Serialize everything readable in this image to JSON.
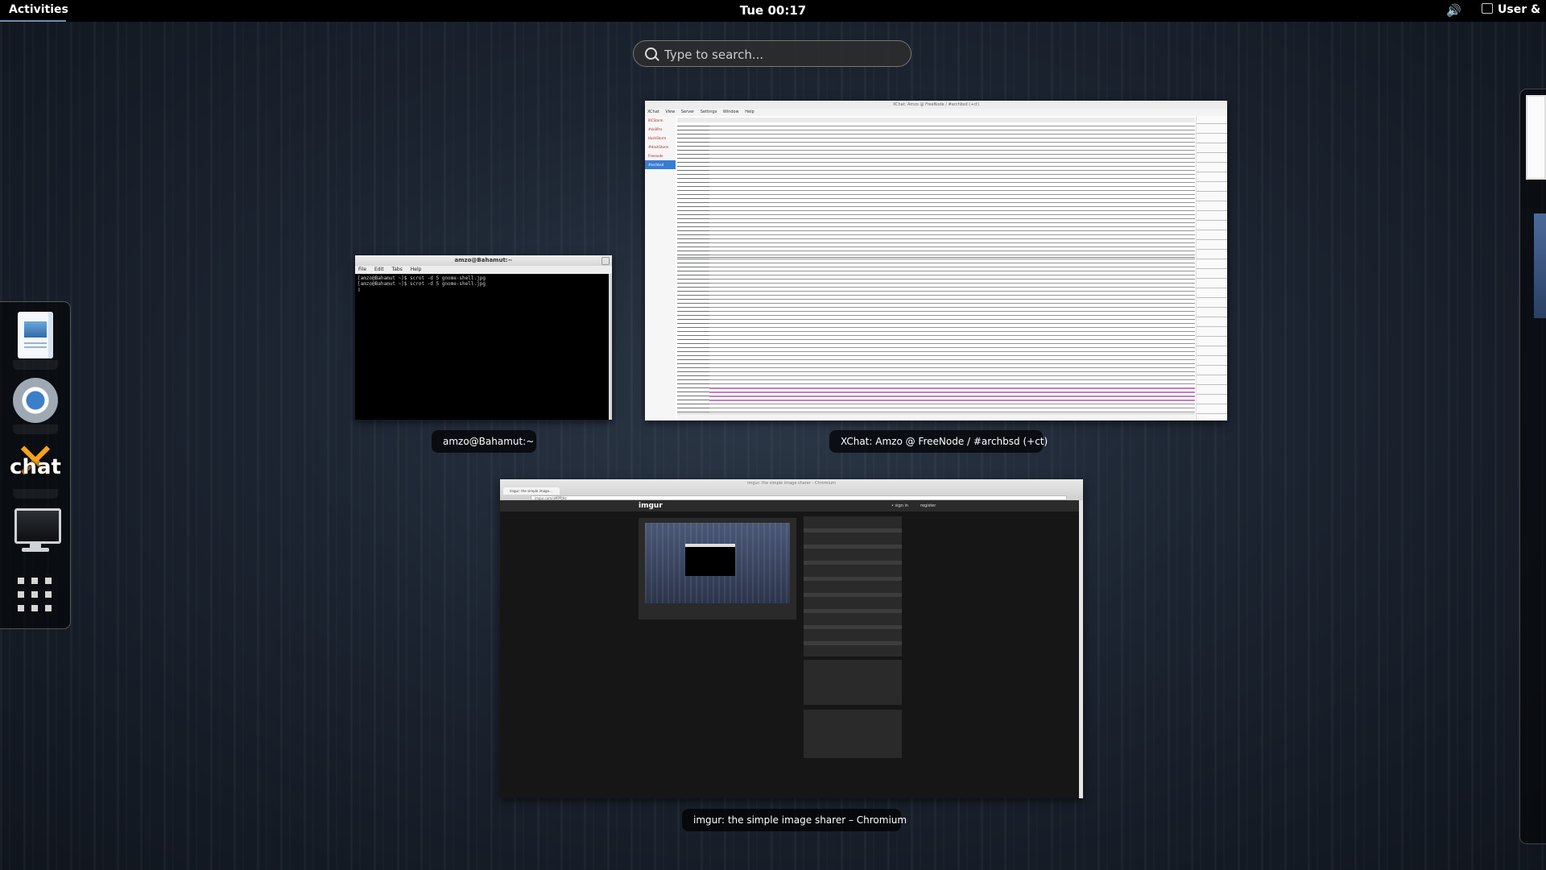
{
  "topbar": {
    "activities": "Activities",
    "clock": "Tue 00:17",
    "user": "User &"
  },
  "search": {
    "placeholder": "Type to search..."
  },
  "dash": {
    "items": [
      {
        "name": "LibreOffice Writer",
        "icon": "document-writer-icon"
      },
      {
        "name": "Chromium",
        "icon": "chromium-icon"
      },
      {
        "name": "XChat",
        "icon": "xchat-icon",
        "text": "chat"
      },
      {
        "name": "Terminal",
        "icon": "monitor-icon"
      },
      {
        "name": "Show Applications",
        "icon": "apps-grid-icon"
      }
    ]
  },
  "windows": {
    "terminal": {
      "title": "amzo@Bahamut:~",
      "label": "amzo@Bahamut:~",
      "menu": [
        "File",
        "Edit",
        "Tabs",
        "Help"
      ],
      "lines": [
        "[amzo@Bahamut ~]$ scrot -d 5 gnome-shell.jpg",
        "[amzo@Bahamut ~]$ scrot -d 5 gnome-shell.jpg"
      ]
    },
    "xchat": {
      "title": "XChat: Amzo @ FreeNode / #archbsd (+ct)",
      "label": "XChat: Amzo @ FreeNode / #archbsd (+ct)",
      "menu": [
        "XChat",
        "View",
        "Server",
        "Settings",
        "Window",
        "Help"
      ],
      "tree": [
        "IRCStorm",
        "#skillPro",
        "HashStorm",
        "#HashStorm",
        "Freenode",
        "#archbsd"
      ]
    },
    "chromium": {
      "title": "imgur: the simple image sharer - Chromium",
      "label": "imgur: the simple image sharer – Chromium",
      "tab": "imgur: the simple image...",
      "url": "imgur.com/nMPPJHz",
      "logo": "imgur",
      "signin": "• sign in",
      "register": "register"
    }
  }
}
